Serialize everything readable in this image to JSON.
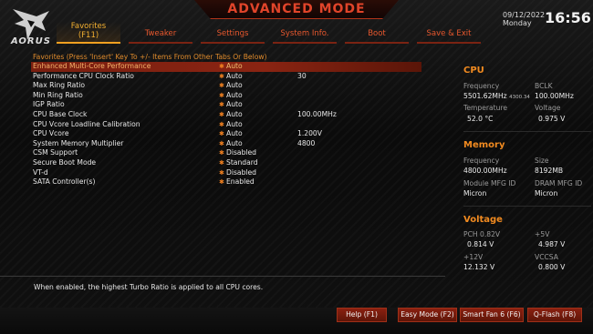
{
  "header": {
    "title": "ADVANCED MODE",
    "brand": "AORUS",
    "date": "09/12/2022",
    "weekday": "Monday",
    "time": "16:56",
    "tabs": [
      {
        "line1": "Favorites",
        "line2": "(F11)",
        "active": true
      },
      {
        "line1": "Tweaker",
        "line2": "",
        "active": false
      },
      {
        "line1": "Settings",
        "line2": "",
        "active": false
      },
      {
        "line1": "System Info.",
        "line2": "",
        "active": false
      },
      {
        "line1": "Boot",
        "line2": "",
        "active": false
      },
      {
        "line1": "Save & Exit",
        "line2": "",
        "active": false
      }
    ]
  },
  "favorites": {
    "hint": "Favorites (Press 'Insert' Key To +/- Items From Other Tabs Or Below)",
    "star_icon": "star-icon",
    "items": [
      {
        "name": "Enhanced Multi-Core Performance",
        "value": "Auto",
        "extra": "",
        "selected": true
      },
      {
        "name": "Performance CPU Clock Ratio",
        "value": "Auto",
        "extra": "30",
        "selected": false
      },
      {
        "name": "Max Ring Ratio",
        "value": "Auto",
        "extra": "",
        "selected": false
      },
      {
        "name": "Min Ring Ratio",
        "value": "Auto",
        "extra": "",
        "selected": false
      },
      {
        "name": "IGP Ratio",
        "value": "Auto",
        "extra": "",
        "selected": false
      },
      {
        "name": "CPU Base Clock",
        "value": "Auto",
        "extra": "100.00MHz",
        "selected": false
      },
      {
        "name": "CPU Vcore Loadline Calibration",
        "value": "Auto",
        "extra": "",
        "selected": false
      },
      {
        "name": "CPU Vcore",
        "value": "Auto",
        "extra": "1.200V",
        "selected": false
      },
      {
        "name": "System Memory Multiplier",
        "value": "Auto",
        "extra": "4800",
        "selected": false
      },
      {
        "name": "CSM Support",
        "value": "Disabled",
        "extra": "",
        "selected": false
      },
      {
        "name": "Secure Boot Mode",
        "value": "Standard",
        "extra": "",
        "selected": false
      },
      {
        "name": "VT-d",
        "value": "Disabled",
        "extra": "",
        "selected": false
      },
      {
        "name": "SATA Controller(s)",
        "value": "Enabled",
        "extra": "",
        "selected": false
      }
    ],
    "help_text": "When enabled, the highest Turbo Ratio is applied to all CPU cores."
  },
  "info": {
    "cpu": {
      "title": "CPU",
      "frequency_label": "Frequency",
      "frequency": "5501.62MHz",
      "frequency_sub": "4300.34",
      "bclk_label": "BCLK",
      "bclk": "100.00MHz",
      "temp_label": "Temperature",
      "temp": "52.0 °C",
      "voltage_label": "Voltage",
      "voltage": "0.975 V"
    },
    "memory": {
      "title": "Memory",
      "frequency_label": "Frequency",
      "frequency": "4800.00MHz",
      "size_label": "Size",
      "size": "8192MB",
      "module_label": "Module MFG ID",
      "module": "Micron",
      "dram_label": "DRAM MFG ID",
      "dram": "Micron"
    },
    "voltage": {
      "title": "Voltage",
      "pch_label": "PCH 0.82V",
      "pch": "0.814 V",
      "v5_label": "+5V",
      "v5": "4.987 V",
      "v12_label": "+12V",
      "v12": "12.132 V",
      "vccsa_label": "VCCSA",
      "vccsa": "0.800 V"
    }
  },
  "footer": {
    "help": "Help (F1)",
    "easy_mode": "Easy Mode (F2)",
    "smart_fan": "Smart Fan 6 (F6)",
    "qflash": "Q-Flash (F8)"
  },
  "colors": {
    "accent_orange": "#f08a20",
    "accent_red": "#e0442a",
    "selected_row": "#7a1f10"
  }
}
